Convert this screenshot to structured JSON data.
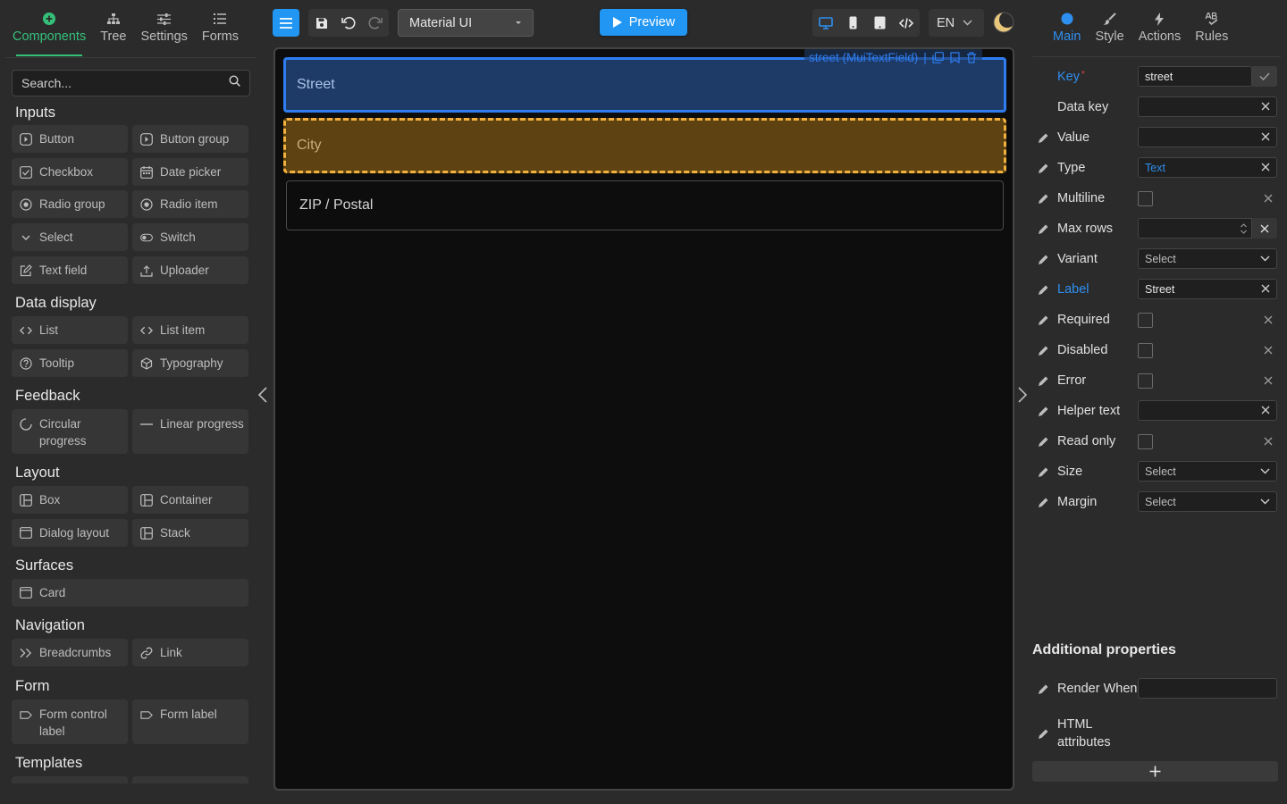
{
  "left_tabs": [
    {
      "label": "Components",
      "icon": "plus-circle-icon",
      "active": true
    },
    {
      "label": "Tree",
      "icon": "tree-icon"
    },
    {
      "label": "Settings",
      "icon": "sliders-icon"
    },
    {
      "label": "Forms",
      "icon": "list-icon"
    }
  ],
  "search": {
    "placeholder": "Search..."
  },
  "sections": {
    "inputs": "Inputs",
    "data_display": "Data display",
    "feedback": "Feedback",
    "layout": "Layout",
    "surfaces": "Surfaces",
    "navigation": "Navigation",
    "form": "Form",
    "templates": "Templates"
  },
  "components": {
    "button": "Button",
    "button_group": "Button group",
    "checkbox": "Checkbox",
    "date_picker": "Date picker",
    "radio_group": "Radio group",
    "radio_item": "Radio item",
    "select": "Select",
    "switch": "Switch",
    "text_field": "Text field",
    "uploader": "Uploader",
    "list": "List",
    "list_item": "List item",
    "tooltip": "Tooltip",
    "typography": "Typography",
    "circular_progress": "Circular progress",
    "linear_progress": "Linear progress",
    "box": "Box",
    "container": "Container",
    "dialog_layout": "Dialog layout",
    "stack": "Stack",
    "card": "Card",
    "breadcrumbs": "Breadcrumbs",
    "link": "Link",
    "form_control_label": "Form control label",
    "form_label": "Form label"
  },
  "toolbar": {
    "library": "Material UI",
    "preview": "Preview",
    "language": "EN"
  },
  "canvas": {
    "selected_tag": "street (MuiTextField)",
    "fields": {
      "street": "Street",
      "city": "City",
      "zip": "ZIP / Postal"
    }
  },
  "right_tabs": [
    {
      "label": "Main",
      "icon": "circle-icon",
      "active": true
    },
    {
      "label": "Style",
      "icon": "brush-icon"
    },
    {
      "label": "Actions",
      "icon": "bolt-icon"
    },
    {
      "label": "Rules",
      "icon": "spellcheck-icon"
    }
  ],
  "props": {
    "key": {
      "label": "Key",
      "value": "street"
    },
    "data_key": {
      "label": "Data key",
      "value": ""
    },
    "value": {
      "label": "Value",
      "value": ""
    },
    "type": {
      "label": "Type",
      "value": "Text"
    },
    "multiline": {
      "label": "Multiline"
    },
    "max_rows": {
      "label": "Max rows"
    },
    "variant": {
      "label": "Variant",
      "value": "Select"
    },
    "label": {
      "label": "Label",
      "value": "Street"
    },
    "required": {
      "label": "Required"
    },
    "disabled": {
      "label": "Disabled"
    },
    "error": {
      "label": "Error"
    },
    "helper_text": {
      "label": "Helper text",
      "value": ""
    },
    "read_only": {
      "label": "Read only"
    },
    "size": {
      "label": "Size",
      "value": "Select"
    },
    "margin": {
      "label": "Margin",
      "value": "Select"
    }
  },
  "additional": {
    "title": "Additional properties",
    "render_when": "Render When",
    "html_attributes": "HTML attributes"
  },
  "colors": {
    "accent_green": "#35c07a",
    "accent_blue": "#2196f3",
    "selected_border": "#2f7df0",
    "hover_border": "#f2b13d"
  }
}
